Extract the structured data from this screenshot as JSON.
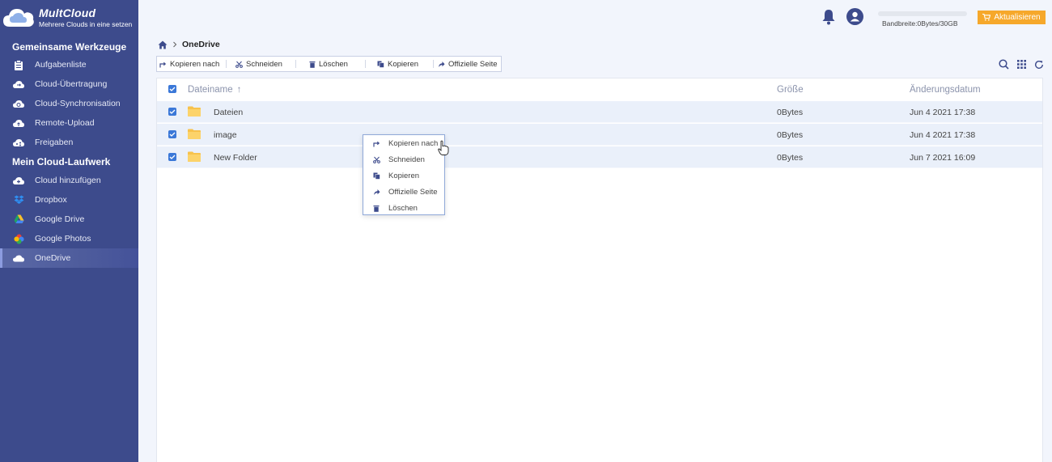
{
  "brand": {
    "name": "MultCloud",
    "tagline": "Mehrere Clouds in eine setzen"
  },
  "sidebar": {
    "section1": "Gemeinsame Werkzeuge",
    "tools": [
      {
        "label": "Aufgabenliste",
        "icon": "clipboard-icon"
      },
      {
        "label": "Cloud-Übertragung",
        "icon": "cloud-transfer-icon"
      },
      {
        "label": "Cloud-Synchronisation",
        "icon": "cloud-sync-icon"
      },
      {
        "label": "Remote-Upload",
        "icon": "cloud-upload-icon"
      },
      {
        "label": "Freigaben",
        "icon": "share-icon"
      }
    ],
    "section2": "Mein Cloud-Laufwerk",
    "drives": [
      {
        "label": "Cloud hinzufügen",
        "icon": "cloud-add-icon"
      },
      {
        "label": "Dropbox",
        "icon": "dropbox-icon"
      },
      {
        "label": "Google Drive",
        "icon": "google-drive-icon"
      },
      {
        "label": "Google Photos",
        "icon": "google-photos-icon"
      },
      {
        "label": "OneDrive",
        "icon": "onedrive-icon",
        "active": true
      }
    ]
  },
  "header": {
    "bandwidth": "Bandbreite:0Bytes/30GB",
    "upgrade_label": "Aktualisieren"
  },
  "breadcrumb": {
    "current": "OneDrive"
  },
  "toolbar": {
    "copy_to": "Kopieren nach",
    "cut": "Schneiden",
    "delete": "Löschen",
    "copy": "Kopieren",
    "official": "Offizielle Seite"
  },
  "table": {
    "headers": {
      "name": "Dateiname",
      "sort_arrow": "↑",
      "size": "Größe",
      "modified": "Änderungsdatum"
    },
    "rows": [
      {
        "name": "Dateien",
        "size": "0Bytes",
        "modified": "Jun 4 2021 17:38"
      },
      {
        "name": "image",
        "size": "0Bytes",
        "modified": "Jun 4 2021 17:38"
      },
      {
        "name": "New Folder",
        "size": "0Bytes",
        "modified": "Jun 7 2021 16:09"
      }
    ]
  },
  "context_menu": {
    "items": [
      {
        "label": "Kopieren nach",
        "icon": "copy-to-icon"
      },
      {
        "label": "Schneiden",
        "icon": "scissors-icon"
      },
      {
        "label": "Kopieren",
        "icon": "copy-icon"
      },
      {
        "label": "Offizielle Seite",
        "icon": "external-share-icon"
      },
      {
        "label": "Löschen",
        "icon": "trash-icon"
      }
    ]
  },
  "colors": {
    "sidebar": "#3d4b8c",
    "accent": "#3b78d8",
    "upgrade": "#f6a82b",
    "row_selected": "#eaf0fa"
  }
}
